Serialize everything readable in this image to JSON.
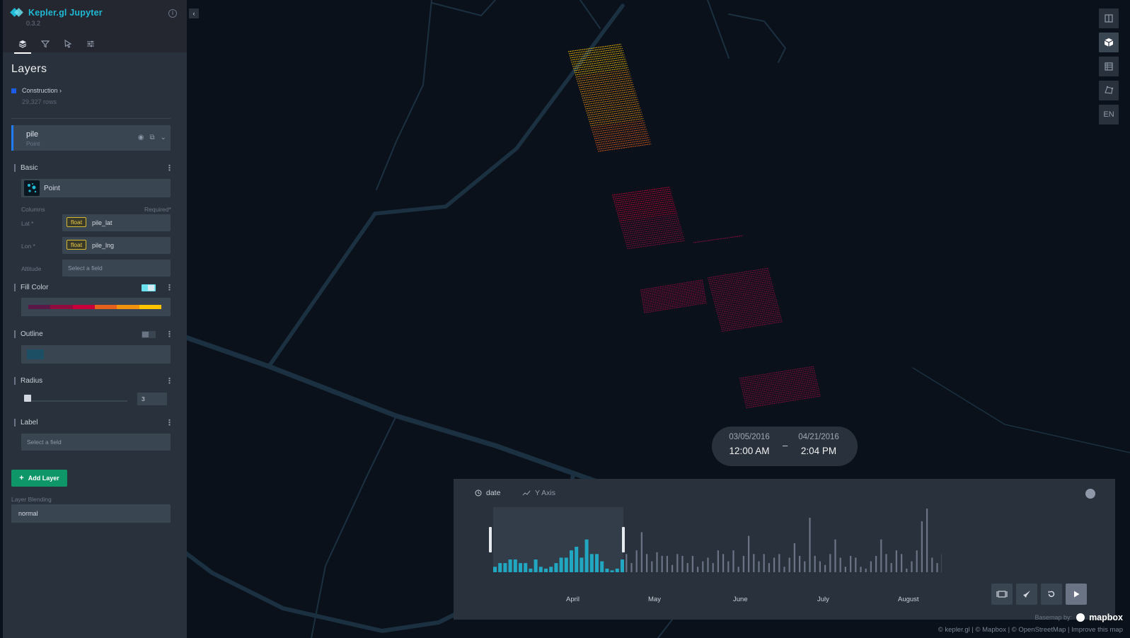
{
  "app": {
    "title": "Kepler.gl Jupyter",
    "version": "0.3.2"
  },
  "tabs": [
    {
      "name": "layers",
      "icon": "layers-icon"
    },
    {
      "name": "filters",
      "icon": "filter-icon"
    },
    {
      "name": "interactions",
      "icon": "cursor-icon"
    },
    {
      "name": "map-style",
      "icon": "sliders-icon"
    }
  ],
  "layers_panel": {
    "title": "Layers",
    "dataset": {
      "name": "Construction ›",
      "rows": "29,327 rows",
      "color": "#1a5ce6"
    },
    "layer": {
      "name": "pile",
      "type": "Point"
    },
    "basic": {
      "title": "Basic",
      "layer_type": "Point",
      "columns_label": "Columns",
      "required_label": "Required*",
      "lat_label": "Lat *",
      "lon_label": "Lon *",
      "alt_label": "Altitude",
      "float_tag": "float",
      "lat_field": "pile_lat",
      "lon_field": "pile_lng",
      "alt_placeholder": "Select a field"
    },
    "fill_color": {
      "title": "Fill Color",
      "palette": [
        "#5a1846",
        "#900c3f",
        "#c70039",
        "#e3611c",
        "#f1920e",
        "#ffc300"
      ]
    },
    "outline": {
      "title": "Outline",
      "color": "#1c4f63"
    },
    "radius": {
      "title": "Radius",
      "value": "3"
    },
    "label": {
      "title": "Label",
      "placeholder": "Select a field"
    },
    "add_layer": "Add Layer",
    "blending_label": "Layer Blending",
    "blending_value": "normal"
  },
  "time_range": {
    "start_date": "03/05/2016",
    "start_time": "12:00 AM",
    "separator": "–",
    "end_date": "04/21/2016",
    "end_time": "2:04 PM"
  },
  "time_widget": {
    "field": "date",
    "y_axis": "Y Axis",
    "months": [
      "April",
      "May",
      "June",
      "July",
      "August"
    ],
    "histogram": [
      3,
      5,
      5,
      7,
      7,
      5,
      5,
      2,
      7,
      3,
      2,
      3,
      5,
      8,
      8,
      12,
      14,
      8,
      18,
      10,
      10,
      6,
      2,
      1,
      2,
      7,
      10,
      5,
      12,
      22,
      10,
      6,
      11,
      9,
      9,
      4,
      10,
      9,
      5,
      9,
      3,
      6,
      8,
      5,
      12,
      10,
      6,
      12,
      3,
      9,
      20,
      10,
      6,
      10,
      5,
      8,
      10,
      3,
      8,
      16,
      9,
      6,
      30,
      9,
      6,
      4,
      10,
      18,
      8,
      3,
      9,
      8,
      3,
      2,
      6,
      9,
      18,
      10,
      5,
      12,
      10,
      2,
      6,
      12,
      28,
      35,
      8,
      5,
      10,
      12,
      16,
      14
    ]
  },
  "map_controls": [
    {
      "icon": "split-map-icon"
    },
    {
      "icon": "3d-map-icon",
      "active": true
    },
    {
      "icon": "legend-icon"
    },
    {
      "icon": "draw-polygon-icon"
    },
    {
      "label": "EN"
    }
  ],
  "attribution": {
    "basemap_label": "Basemap by:",
    "brand": "mapbox",
    "text": "© kepler.gl | © Mapbox | © OpenStreetMap | Improve this map"
  },
  "colors": {
    "accent": "#1fbad6",
    "brand_green": "#0f9668",
    "selected_bar": "#1fbad6",
    "unselected_bar": "#6a7485",
    "road": "#1c3344"
  }
}
